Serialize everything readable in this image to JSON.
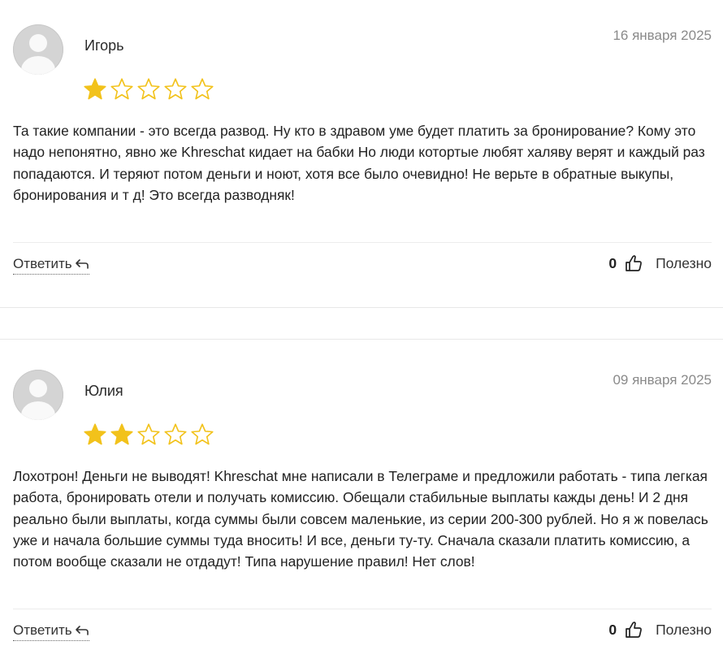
{
  "colors": {
    "star_filled": "#f2c21b",
    "star_empty": "#f2c21b",
    "date": "#8a8a8a",
    "divider": "#ececec"
  },
  "icons": {
    "avatar": "user-avatar-placeholder",
    "reply": "reply-arrow-icon",
    "thumb": "thumbs-up-icon",
    "star": "star-icon"
  },
  "reviews": [
    {
      "author": "Игорь",
      "date": "16 января 2025",
      "rating": 1,
      "rating_max": 5,
      "text": "Та такие компании - это всегда развод. Ну кто в здравом уме будет платить за бронирование? Кому это надо непонятно, явно же Khreschat кидает на бабки Но люди котортые любят халяву верят и каждый раз попадаются. И теряют потом деньги и ноют, хотя все было очевидно! Не верьте в обратные выкупы, бронирования и т д! Это всегда разводняк!",
      "reply_label": "Ответить",
      "useful_count": "0",
      "useful_label": "Полезно"
    },
    {
      "author": "Юлия",
      "date": "09 января 2025",
      "rating": 2,
      "rating_max": 5,
      "text": "Лохотрон! Деньги не выводят! Khreschat мне написали в Телеграме и предложили работать - типа легкая работа, бронировать отели и получать комиссию. Обещали стабильные выплаты кажды день! И 2 дня реально были выплаты, когда суммы были совсем маленькие, из серии 200-300 рублей. Но я ж повелась уже и начала большие суммы туда вносить! И все, деньги ту-ту. Сначала сказали платить комиссию, а потом вообще сказали не отдадут! Типа нарушение правил! Нет слов!",
      "reply_label": "Ответить",
      "useful_count": "0",
      "useful_label": "Полезно"
    }
  ]
}
